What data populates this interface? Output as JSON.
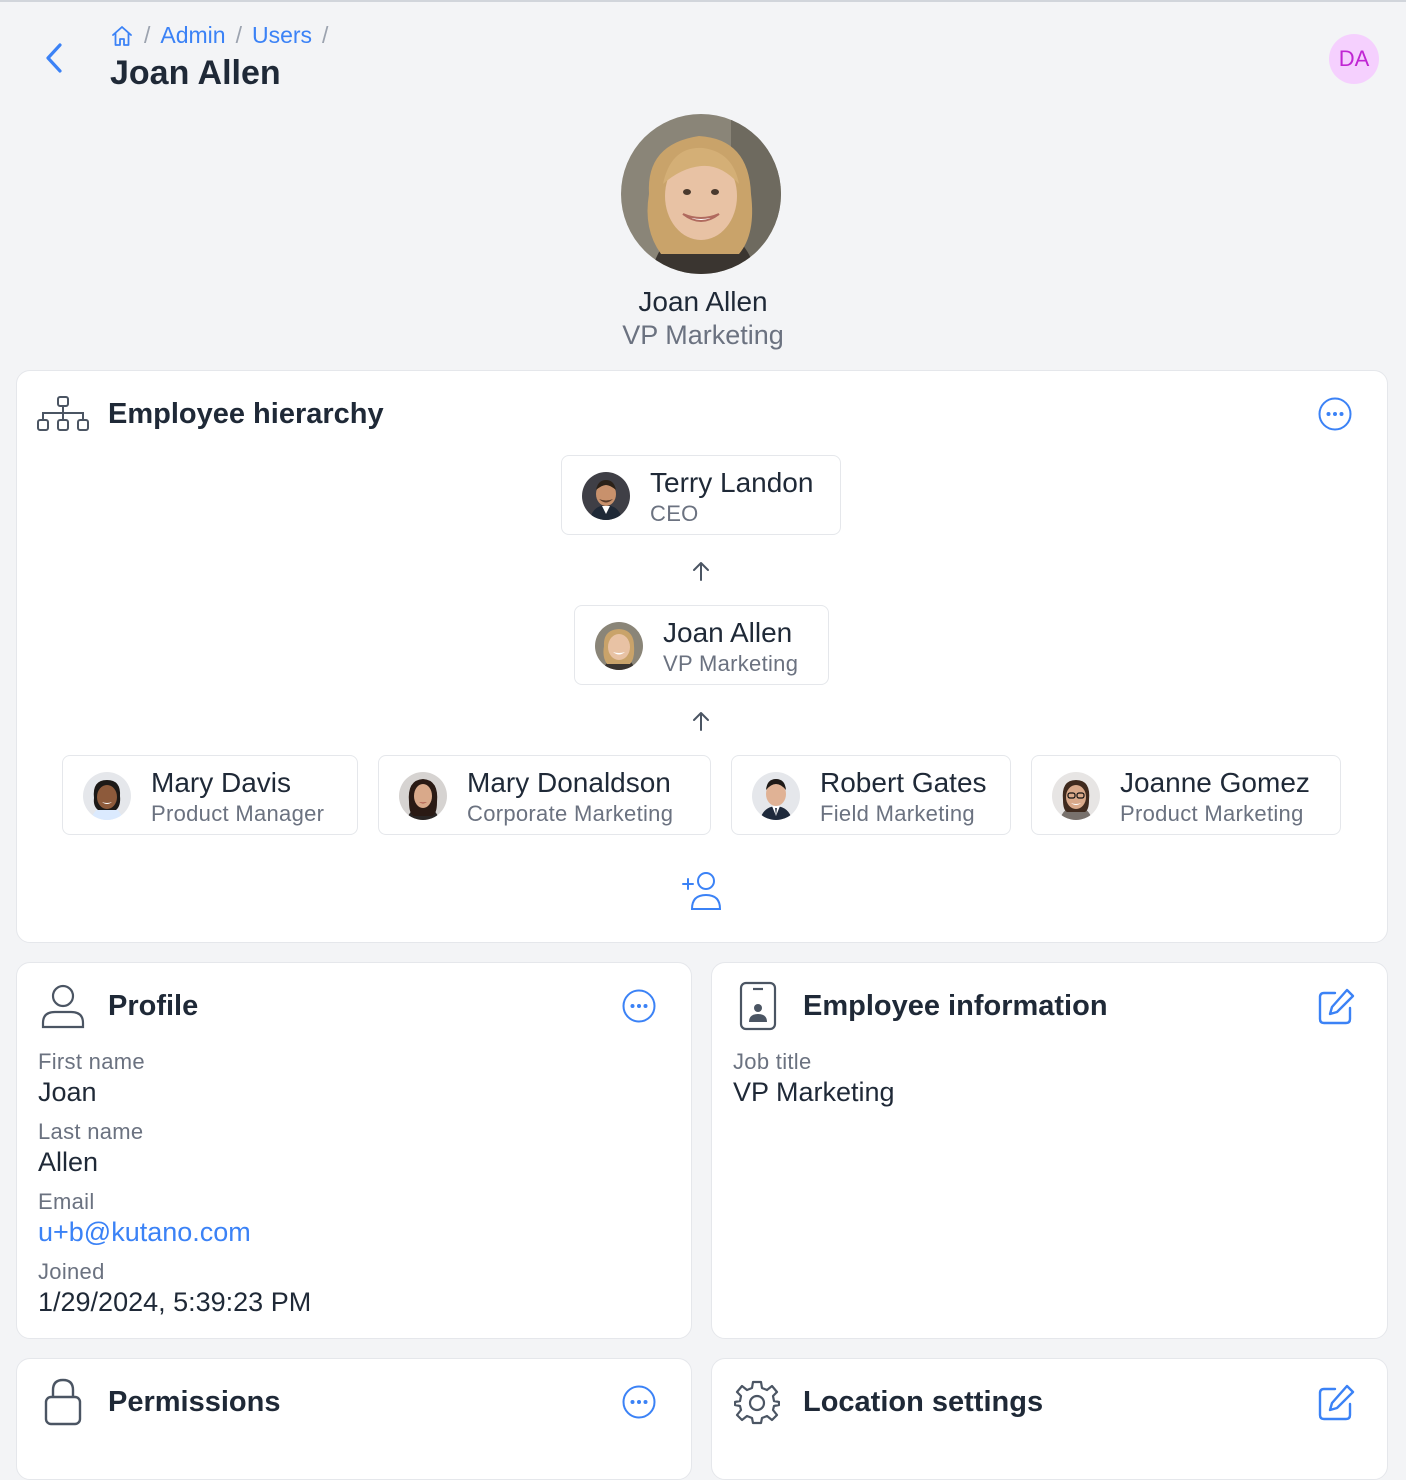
{
  "breadcrumb": {
    "home_icon": "home-icon",
    "items": [
      "Admin",
      "Users"
    ],
    "separator": "/"
  },
  "page_title": "Joan Allen",
  "current_user": {
    "initials": "DA",
    "badge_bg": "#f5d0fe",
    "badge_fg": "#c026d3"
  },
  "profile_header": {
    "name": "Joan Allen",
    "title": "VP Marketing"
  },
  "hierarchy": {
    "title": "Employee hierarchy",
    "icon": "org-chart-icon",
    "manager": {
      "name": "Terry Landon",
      "role": "CEO"
    },
    "current": {
      "name": "Joan Allen",
      "role": "VP Marketing"
    },
    "reports": [
      {
        "name": "Mary Davis",
        "role": "Product Manager"
      },
      {
        "name": "Mary Donaldson",
        "role": "Corporate Marketing"
      },
      {
        "name": "Robert Gates",
        "role": "Field Marketing"
      },
      {
        "name": "Joanne Gomez",
        "role": "Product Marketing"
      }
    ],
    "add_icon": "add-user-icon"
  },
  "profile": {
    "title": "Profile",
    "icon": "user-icon",
    "fields": [
      {
        "label": "First name",
        "value": "Joan"
      },
      {
        "label": "Last name",
        "value": "Allen"
      },
      {
        "label": "Email",
        "value": "u+b@kutano.com"
      },
      {
        "label": "Joined",
        "value": "1/29/2024, 5:39:23 PM"
      }
    ]
  },
  "employee_info": {
    "title": "Employee information",
    "icon": "id-badge-icon",
    "fields": [
      {
        "label": "Job title",
        "value": "VP Marketing"
      }
    ]
  },
  "permissions": {
    "title": "Permissions",
    "icon": "lock-icon"
  },
  "location_settings": {
    "title": "Location settings",
    "icon": "gear-icon"
  },
  "colors": {
    "accent": "#3b82f6",
    "background": "#f3f4f6",
    "card": "#ffffff",
    "muted": "#6b7280"
  }
}
